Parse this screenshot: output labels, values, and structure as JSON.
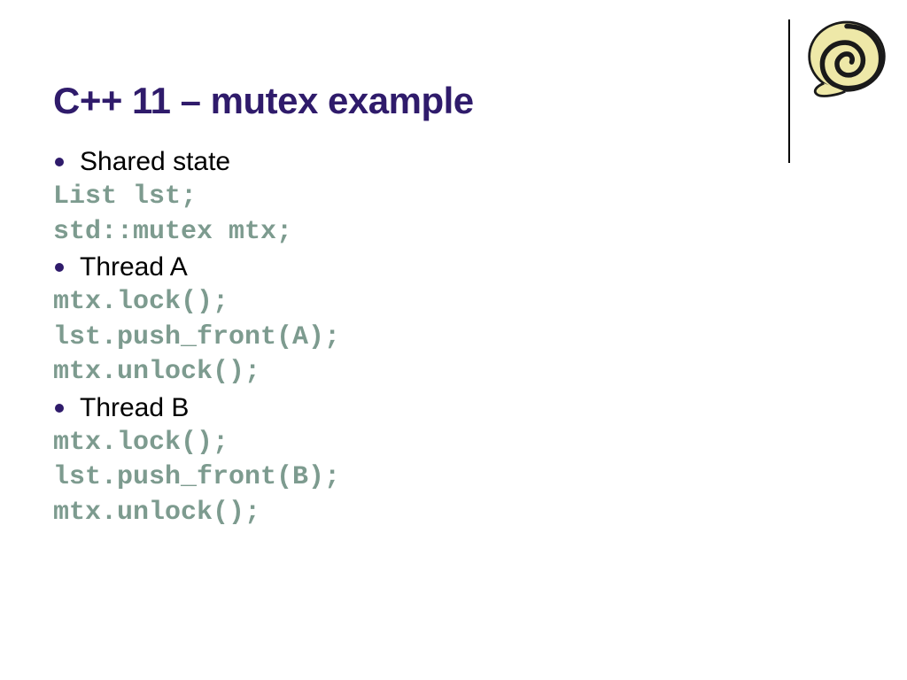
{
  "title": "C++ 11 – mutex example",
  "bullets": {
    "b0": "Shared state",
    "b1": "Thread A",
    "b2": "Thread B"
  },
  "code": {
    "shared0": "List lst;",
    "shared1": "std::mutex mtx;",
    "a0": "mtx.lock();",
    "a1": "lst.push_front(A);",
    "a2": "mtx.unlock();",
    "b0": "mtx.lock();",
    "b1": "lst.push_front(B);",
    "b2": "mtx.unlock();"
  }
}
